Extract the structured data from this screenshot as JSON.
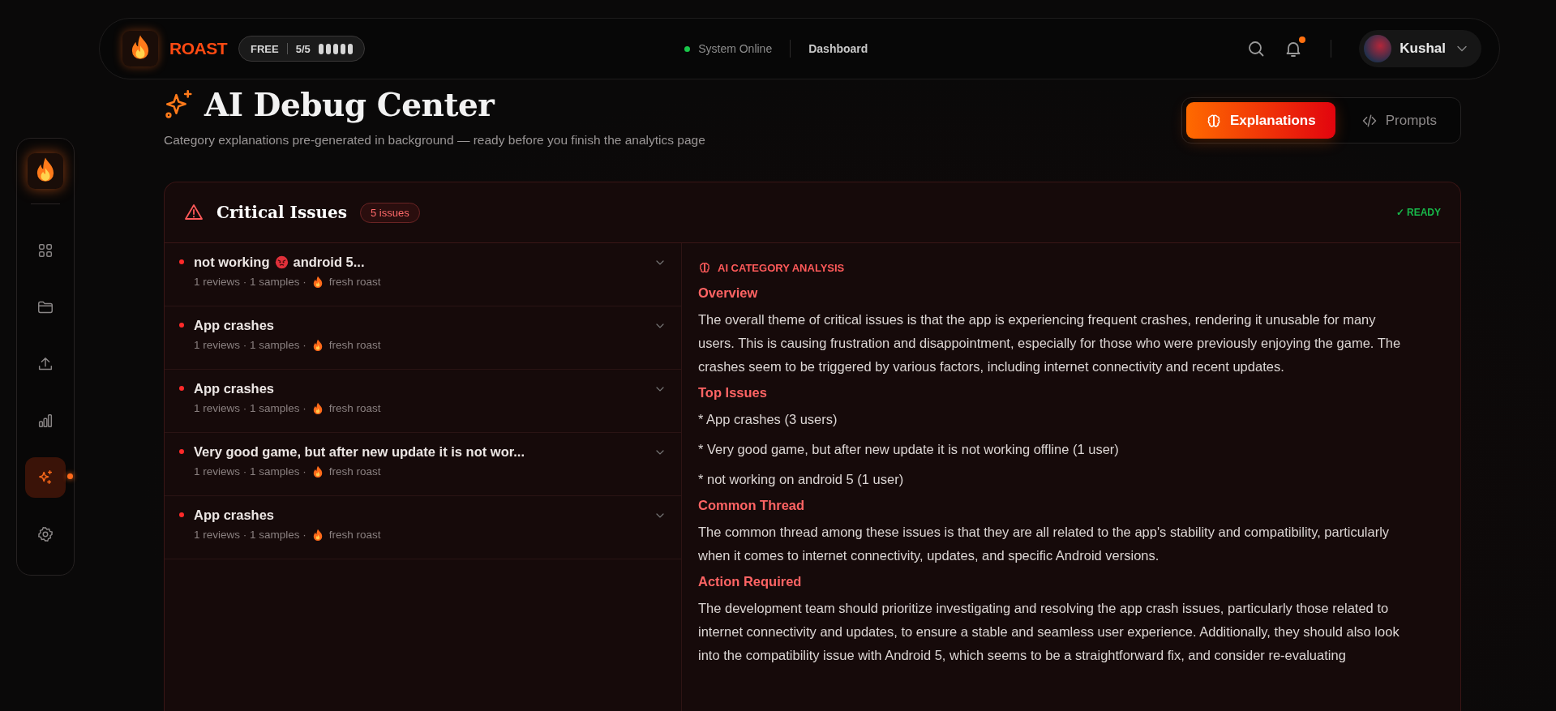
{
  "topbar": {
    "brand": "ROAST",
    "plan": "FREE",
    "usage": "5/5",
    "usage_meter": {
      "level": 1
    },
    "status": {
      "label": "System Online",
      "online": true
    },
    "nav_link": "Dashboard",
    "notifications": {
      "unread": true
    },
    "user": {
      "name": "Kushal"
    }
  },
  "sidebar": {
    "items": [
      {
        "kind": "grid",
        "selected": false
      },
      {
        "kind": "folder",
        "selected": false
      },
      {
        "kind": "upload",
        "selected": false
      },
      {
        "kind": "chart",
        "selected": false
      },
      {
        "kind": "sparkle",
        "selected": true
      },
      {
        "kind": "settings",
        "selected": false
      }
    ]
  },
  "header": {
    "title": "AI Debug Center",
    "subtitle": "Category explanations pre-generated in background — ready before you finish the analytics page",
    "tabs": [
      {
        "label": "Explanations",
        "kind": "brain",
        "selected": true
      },
      {
        "label": "Prompts",
        "kind": "code",
        "selected": false
      }
    ]
  },
  "card": {
    "title": "Critical Issues",
    "count": "5 issues",
    "status": "✓ READY",
    "items": [
      {
        "title_parts": [
          "not working",
          "android 5..."
        ],
        "meta": "1 reviews · 1 samples ·",
        "tag": "fresh roast",
        "expanded": false
      },
      {
        "title_parts": [
          "App crashes"
        ],
        "meta": "1 reviews · 1 samples ·",
        "tag": "fresh roast",
        "expanded": false
      },
      {
        "title_parts": [
          "App crashes"
        ],
        "meta": "1 reviews · 1 samples ·",
        "tag": "fresh roast",
        "expanded": false
      },
      {
        "title_parts": [
          "Very good game, but after new update it is not wor..."
        ],
        "meta": "1 reviews · 1 samples ·",
        "tag": "fresh roast",
        "expanded": false
      },
      {
        "title_parts": [
          "App crashes"
        ],
        "meta": "1 reviews · 1 samples ·",
        "tag": "fresh roast",
        "expanded": false
      }
    ],
    "analysis": {
      "label": "AI CATEGORY ANALYSIS",
      "blocks": [
        {
          "kind": "heading",
          "text": "Overview"
        },
        {
          "kind": "paragraph",
          "text": "The overall theme of critical issues is that the app is experiencing frequent crashes, rendering it unusable for many users. This is causing frustration and disappointment, especially for those who were previously enjoying the game. The crashes seem to be triggered by various factors, including internet connectivity and recent updates."
        },
        {
          "kind": "heading",
          "text": "Top Issues"
        },
        {
          "kind": "paragraph",
          "text": "* App crashes (3 users)"
        },
        {
          "kind": "paragraph",
          "text": "* Very good game, but after new update it is not working offline (1 user)"
        },
        {
          "kind": "paragraph",
          "text": "* not working on android 5 (1 user)"
        },
        {
          "kind": "heading",
          "text": "Common Thread"
        },
        {
          "kind": "paragraph",
          "text": "The common thread among these issues is that they are all related to the app's stability and compatibility, particularly when it comes to internet connectivity, updates, and specific Android versions."
        },
        {
          "kind": "heading",
          "text": "Action Required"
        },
        {
          "kind": "paragraph",
          "text": "The development team should prioritize investigating and resolving the app crash issues, particularly those related to internet connectivity and updates, to ensure a stable and seamless user experience. Additionally, they should also look into the compatibility issue with Android 5, which seems to be a straightforward fix, and consider re-evaluating"
        }
      ]
    }
  }
}
